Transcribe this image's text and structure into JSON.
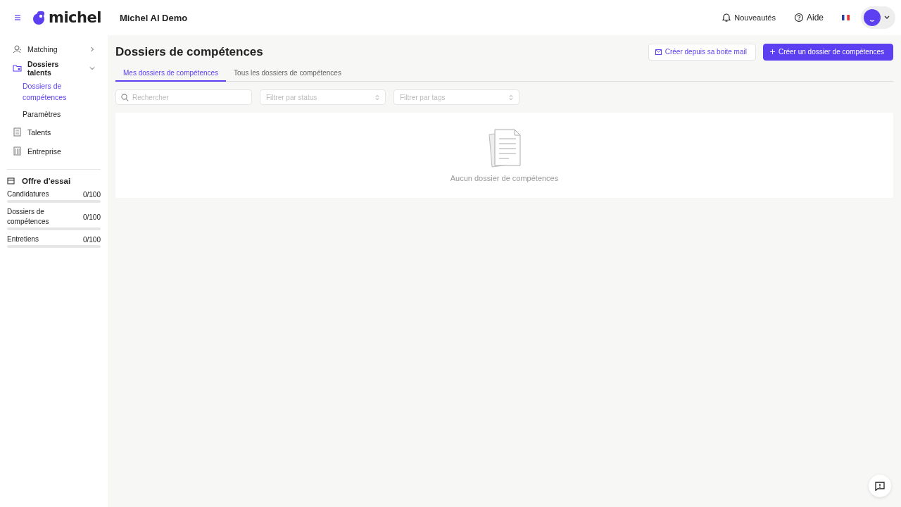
{
  "header": {
    "logo": "michel",
    "workspace": "Michel AI Demo",
    "links": [
      {
        "label": "Nouveautés"
      },
      {
        "label": "Aide"
      }
    ]
  },
  "sidebar": {
    "items": [
      {
        "label": "Matching",
        "expanded": false,
        "selected": false
      },
      {
        "label": "Dossiers talents",
        "expanded": true,
        "selected": false,
        "children": [
          {
            "label": "Dossiers de compétences",
            "selected": true
          },
          {
            "label": "Paramètres",
            "selected": false
          }
        ]
      },
      {
        "label": "Talents",
        "selected": false
      },
      {
        "label": "Entreprise",
        "selected": false
      }
    ],
    "plan": {
      "title": "Offre d'essai",
      "usage": [
        {
          "label": "Candidatures",
          "count": "0/100",
          "level": 0
        },
        {
          "label": "Dossiers de compétences",
          "count": "0/100",
          "level": 0
        },
        {
          "label": "Entretiens",
          "count": "0/100",
          "level": 0
        }
      ]
    }
  },
  "main": {
    "title": "Dossiers de compétences",
    "buttons": [
      {
        "kind": "secondary",
        "label": "Créer depuis sa boite mail"
      },
      {
        "kind": "primary",
        "label": "Créer un dossier de compétences"
      }
    ],
    "tabs": [
      {
        "label": "Mes dossiers de compétences",
        "selected": true
      },
      {
        "label": "Tous les dossiers de compétences",
        "selected": false
      }
    ],
    "search": {
      "placeholder": "Rechercher"
    },
    "filters": [
      {
        "placeholder": "Filtrer par status"
      },
      {
        "placeholder": "Filtrer par tags"
      }
    ],
    "empty_message": "Aucun dossier de compétences"
  }
}
